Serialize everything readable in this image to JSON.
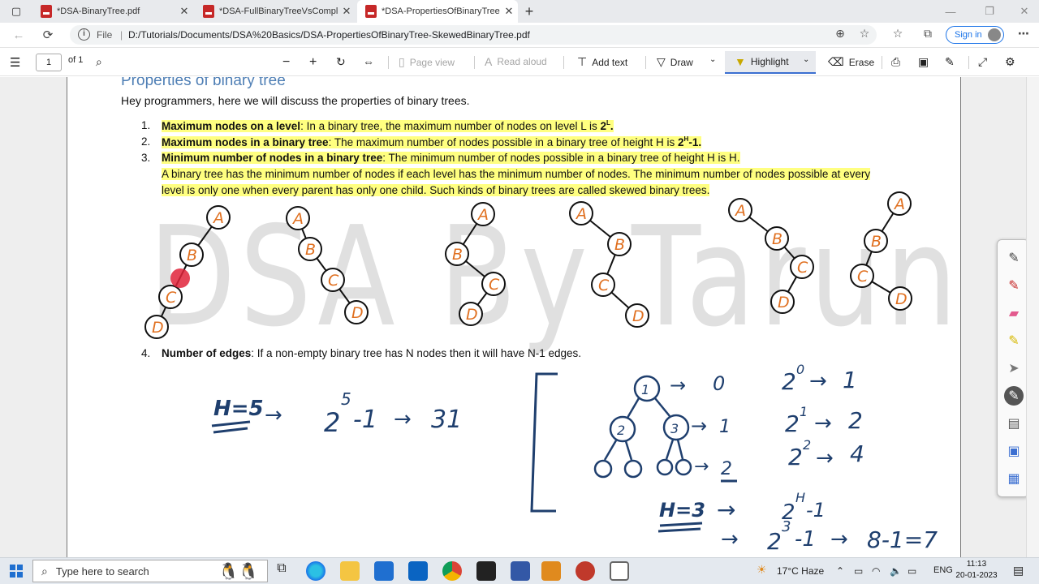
{
  "tabs": [
    {
      "label": "*DSA-BinaryTree.pdf",
      "active": false
    },
    {
      "label": "*DSA-FullBinaryTreeVsCompleteBi",
      "active": false
    },
    {
      "label": "*DSA-PropertiesOfBinaryTree-Sk",
      "active": true
    }
  ],
  "address": {
    "scheme_label": "File",
    "url": "D:/Tutorials/Documents/DSA%20Basics/DSA-PropertiesOfBinaryTree-SkewedBinaryTree.pdf",
    "signin_label": "Sign in"
  },
  "toolbar": {
    "page_number": "1",
    "page_total": "of 1",
    "page_view": "Page view",
    "read_aloud": "Read aloud",
    "add_text": "Add text",
    "draw": "Draw",
    "highlight": "Highlight",
    "erase": "Erase"
  },
  "document": {
    "title": "Properties of binary tree",
    "intro": "Hey programmers, here we will discuss the properties of binary trees.",
    "items": [
      {
        "num": "1.",
        "bold": "Maximum nodes on a level",
        "text": ": In a binary tree, the maximum number of nodes on level L is ",
        "formula_base": "2",
        "formula_sup": "L",
        "formula_tail": "."
      },
      {
        "num": "2.",
        "bold": "Maximum nodes in a binary tree",
        "text": ": The maximum number of nodes possible in a binary tree of height H is ",
        "formula_base": "2",
        "formula_sup": "H",
        "formula_tail": "-1."
      },
      {
        "num": "3.",
        "bold": "Minimum number of nodes in a binary tree",
        "text": ": The minimum number of nodes possible in a binary tree of height H is H."
      },
      {
        "num": "4.",
        "bold": "Number of edges",
        "text": ": If a non-empty binary tree has N nodes then it will have N-1 edges."
      }
    ],
    "item3_para_line1": "A binary tree has the minimum number of nodes if each level has the minimum number of nodes. The minimum number of nodes possible at every",
    "item3_para_line2": "level is only one when every parent has only one child. Such kinds of binary trees are called skewed binary trees.",
    "watermark": "DSA By Tarun Sir"
  },
  "annotations": {
    "tree_labels": [
      "A",
      "B",
      "C",
      "D"
    ],
    "calc_left": {
      "h": "H=5",
      "base": "2",
      "exp": "5",
      "rest": "-1",
      "result": "31"
    },
    "levels": [
      {
        "node": "1",
        "level": "0",
        "pow": "2",
        "exp": "0",
        "count": "1"
      },
      {
        "node": "2",
        "level": "1",
        "pow": "2",
        "exp": "1",
        "count": "2"
      },
      {
        "node": "3",
        "level": "2",
        "pow": "2",
        "exp": "2",
        "count": "4"
      }
    ],
    "calc_bottom": {
      "h": "H=3",
      "line1_base": "2",
      "line1_exp": "H",
      "line1_rest": "-1",
      "line2_base": "2",
      "line2_exp": "3",
      "line2_rest": "-1",
      "line2_mid": "8-1=7"
    },
    "ink_blue": "#1f3f6e",
    "ink_orange": "#e07020"
  },
  "taskbar": {
    "search_placeholder": "Type here to search",
    "weather": "17°C  Haze",
    "language": "ENG",
    "time": "11:13",
    "date": "20-01-2023"
  }
}
